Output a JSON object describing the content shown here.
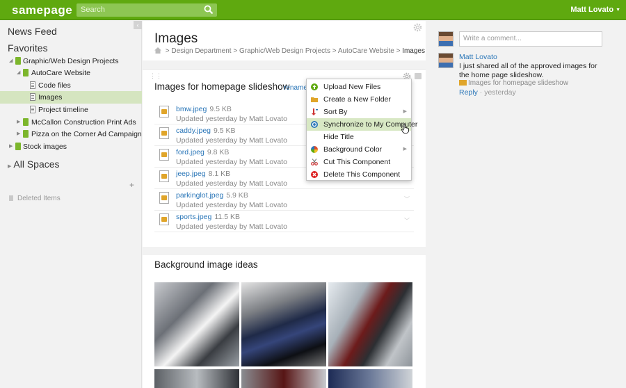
{
  "topbar": {
    "logo": "samepage",
    "search_placeholder": "Search",
    "user": "Matt Lovato",
    "brand_color": "#5fa90f"
  },
  "sidebar": {
    "collapse_icon": "chevron-left-icon",
    "news_feed": "News Feed",
    "favorites": "Favorites",
    "tree": [
      {
        "label": "Graphic/Web Design Projects",
        "type": "folder",
        "expanded": true
      },
      {
        "label": "AutoCare Website",
        "type": "folder",
        "expanded": true
      },
      {
        "label": "Code files",
        "type": "doc"
      },
      {
        "label": "Images",
        "type": "doc",
        "selected": true
      },
      {
        "label": "Project timeline",
        "type": "doc"
      },
      {
        "label": "McCallon Construction Print Ads",
        "type": "folder",
        "expanded": false
      },
      {
        "label": "Pizza on the Corner Ad Campaign",
        "type": "folder",
        "expanded": false
      },
      {
        "label": "Stock images",
        "type": "folder",
        "expanded": false
      }
    ],
    "all_spaces": "All Spaces",
    "plus": "+",
    "deleted_items": "Deleted Items"
  },
  "main": {
    "title": "Images",
    "breadcrumb": {
      "sep": ">",
      "items": [
        "Design Department",
        "Graphic/Web Design Projects",
        "AutoCare Website"
      ],
      "current": "Images"
    },
    "component_title": "Images for homepage slideshow",
    "rename": "rename",
    "files": [
      {
        "name": "bmw.jpeg",
        "size": "9.5 KB",
        "meta": "Updated yesterday by Matt Lovato"
      },
      {
        "name": "caddy.jpeg",
        "size": "9.5 KB",
        "meta": "Updated yesterday by Matt Lovato"
      },
      {
        "name": "ford.jpeg",
        "size": "9.8 KB",
        "meta": "Updated yesterday by Matt Lovato"
      },
      {
        "name": "jeep.jpeg",
        "size": "8.1 KB",
        "meta": "Updated yesterday by Matt Lovato"
      },
      {
        "name": "parkinglot.jpeg",
        "size": "5.9 KB",
        "meta": "Updated yesterday by Matt Lovato"
      },
      {
        "name": "sports.jpeg",
        "size": "11.5 KB",
        "meta": "Updated yesterday by Matt Lovato"
      }
    ],
    "gallery_title": "Background image ideas"
  },
  "context_menu": {
    "items": [
      {
        "label": "Upload New Files",
        "icon": "upload-icon",
        "color": "#5fa90f"
      },
      {
        "label": "Create a New Folder",
        "icon": "folder-icon",
        "color": "#e0a52a"
      },
      {
        "label": "Sort By",
        "icon": "sort-icon",
        "color": "#c33",
        "submenu": true
      },
      {
        "label": "Synchronize to My Computer",
        "icon": "sync-icon",
        "color": "#2a76b8",
        "hover": true
      },
      {
        "label": "Hide Title",
        "icon": "",
        "color": ""
      },
      {
        "label": "Background Color",
        "icon": "color-wheel-icon",
        "color": "#e04c2a",
        "submenu": true
      },
      {
        "label": "Cut This Component",
        "icon": "scissors-icon",
        "color": "#c33"
      },
      {
        "label": "Delete This Component",
        "icon": "delete-icon",
        "color": "#d22"
      }
    ]
  },
  "comments": {
    "placeholder": "Write a comment...",
    "author": "Matt Lovato",
    "body": "I just shared all of the approved images for the home page slideshow.",
    "attachment": "Images for homepage slideshow",
    "reply": "Reply",
    "time": "· yesterday"
  }
}
